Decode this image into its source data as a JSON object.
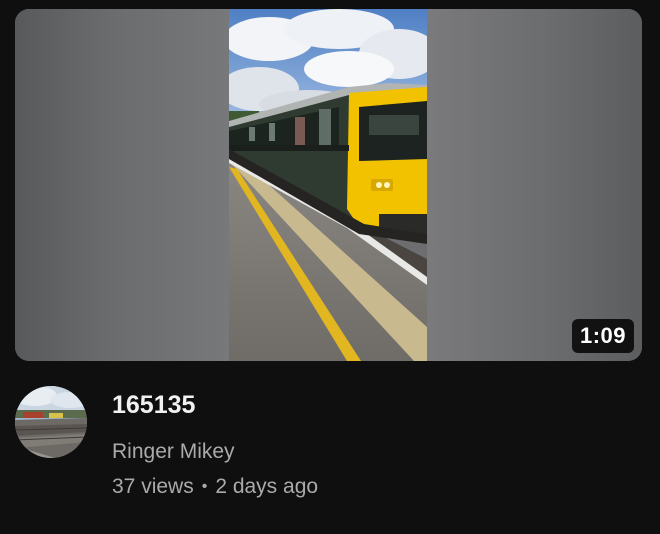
{
  "video": {
    "title": "165135",
    "duration": "1:09",
    "channel": "Ringer Mikey",
    "views": "37 views",
    "separator": "•",
    "age": "2 days ago"
  },
  "thumbnail": {
    "description_icon": "train-photo"
  },
  "avatar": {
    "icon": "channel-avatar-train-yard"
  },
  "colors": {
    "background": "#0f0f0f",
    "title_text": "#f1f1f1",
    "secondary_text": "#aaaaaa",
    "train_yellow": "#f2c200",
    "train_green": "#2d3a2f"
  }
}
